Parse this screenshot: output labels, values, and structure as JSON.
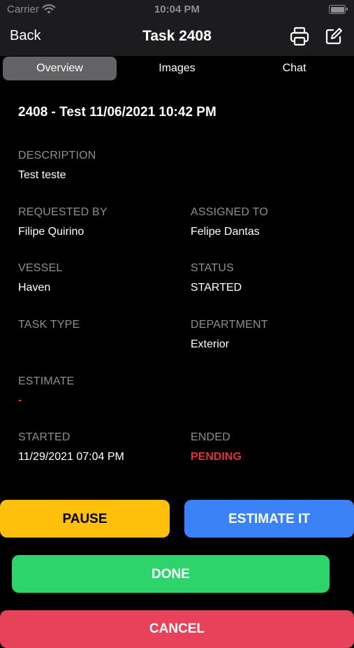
{
  "status_bar": {
    "carrier": "Carrier",
    "time": "10:04 PM"
  },
  "nav": {
    "back_label": "Back",
    "title": "Task 2408"
  },
  "tabs": [
    {
      "label": "Overview",
      "active": true
    },
    {
      "label": "Images",
      "active": false
    },
    {
      "label": "Chat",
      "active": false
    }
  ],
  "task": {
    "heading": "2408 - Test 11/06/2021 10:42 PM",
    "description_label": "DESCRIPTION",
    "description": "Test teste",
    "requested_by_label": "REQUESTED BY",
    "requested_by": "Filipe Quirino",
    "assigned_to_label": "ASSIGNED TO",
    "assigned_to": "Felipe Dantas",
    "vessel_label": "VESSEL",
    "vessel": "Haven",
    "status_label": "STATUS",
    "status": "STARTED",
    "task_type_label": "TASK TYPE",
    "task_type": "",
    "department_label": "DEPARTMENT",
    "department": "Exterior",
    "estimate_label": "ESTIMATE",
    "estimate": "-",
    "started_label": "STARTED",
    "started": "11/29/2021 07:04 PM",
    "ended_label": "ENDED",
    "ended": "PENDING"
  },
  "actions": {
    "pause_label": "PAUSE",
    "estimate_label": "ESTIMATE IT",
    "done_label": "DONE",
    "cancel_label": "CANCEL"
  },
  "colors": {
    "pause": "#fec00d",
    "estimate": "#3a82f6",
    "done": "#2dd46b",
    "cancel": "#e8415a",
    "pending": "#e0313f"
  },
  "icons": {
    "wifi": "wifi-icon",
    "battery": "battery-icon",
    "print": "printer-icon",
    "edit": "edit-icon"
  }
}
